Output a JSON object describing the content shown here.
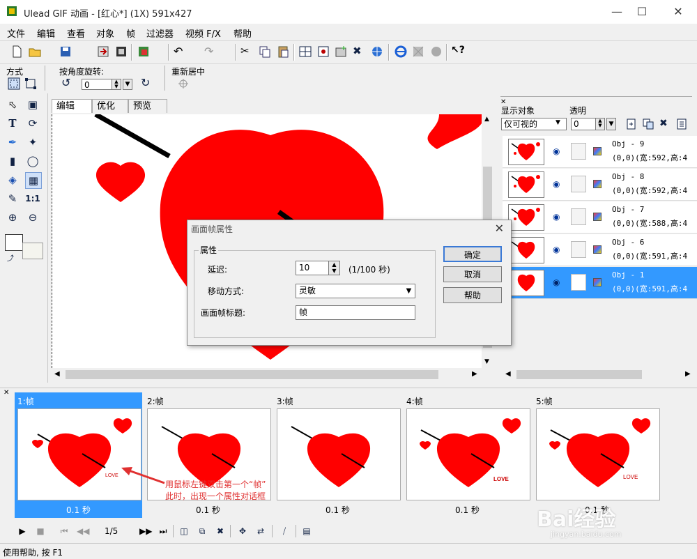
{
  "window": {
    "title": "Ulead GIF 动画 - [红心*] (1X) 591x427"
  },
  "menu": [
    "文件",
    "编辑",
    "查看",
    "对象",
    "帧",
    "过滤器",
    "视频 F/X",
    "帮助"
  ],
  "options": {
    "mode_label": "方式",
    "rotate_label": "按角度旋转:",
    "rotate_value": "0",
    "recenter_label": "重新居中"
  },
  "tabs": [
    "编辑",
    "优化",
    "预览"
  ],
  "objects": {
    "show_label": "显示对象",
    "show_value": "仅可视的",
    "opacity_label": "透明",
    "opacity_value": "0",
    "rows": [
      {
        "name": "Obj - 9",
        "info": "(0,0)(宽:592,高:4"
      },
      {
        "name": "Obj - 8",
        "info": "(0,0)(宽:592,高:4"
      },
      {
        "name": "Obj - 7",
        "info": "(0,0)(宽:588,高:4"
      },
      {
        "name": "Obj - 6",
        "info": "(0,0)(宽:591,高:4"
      },
      {
        "name": "Obj - 1",
        "info": "(0,0)(宽:591,高:4"
      }
    ]
  },
  "frames": [
    {
      "label": "1:帧",
      "delay": "0.1 秒",
      "love": "LOVE"
    },
    {
      "label": "2:帧",
      "delay": "0.1 秒",
      "love": ""
    },
    {
      "label": "3:帧",
      "delay": "0.1 秒",
      "love": ""
    },
    {
      "label": "4:帧",
      "delay": "0.1 秒",
      "love": "LOVE"
    },
    {
      "label": "5:帧",
      "delay": "0.1 秒",
      "love": "LOVE"
    }
  ],
  "controls": {
    "frame_counter": "1/5"
  },
  "status": "使用帮助, 按 F1",
  "annotation": {
    "line1": "用鼠标左键双击第一个“帧”",
    "line2": "此时，出现一个属性对话框"
  },
  "dialog": {
    "title": "画面帧属性",
    "group": "属性",
    "delay_label": "延迟:",
    "delay_value": "10",
    "delay_unit": "(1/100 秒)",
    "move_label": "移动方式:",
    "move_value": "灵敏",
    "caption_label": "画面帧标题:",
    "caption_value": "帧",
    "ok": "确定",
    "cancel": "取消",
    "help": "帮助"
  },
  "watermark": {
    "brand": "Bai经验",
    "url": "jingyan.baidu.com"
  },
  "colors": {
    "accent": "#3399ff",
    "heart": "#ff0000",
    "annotation": "#e03030"
  }
}
